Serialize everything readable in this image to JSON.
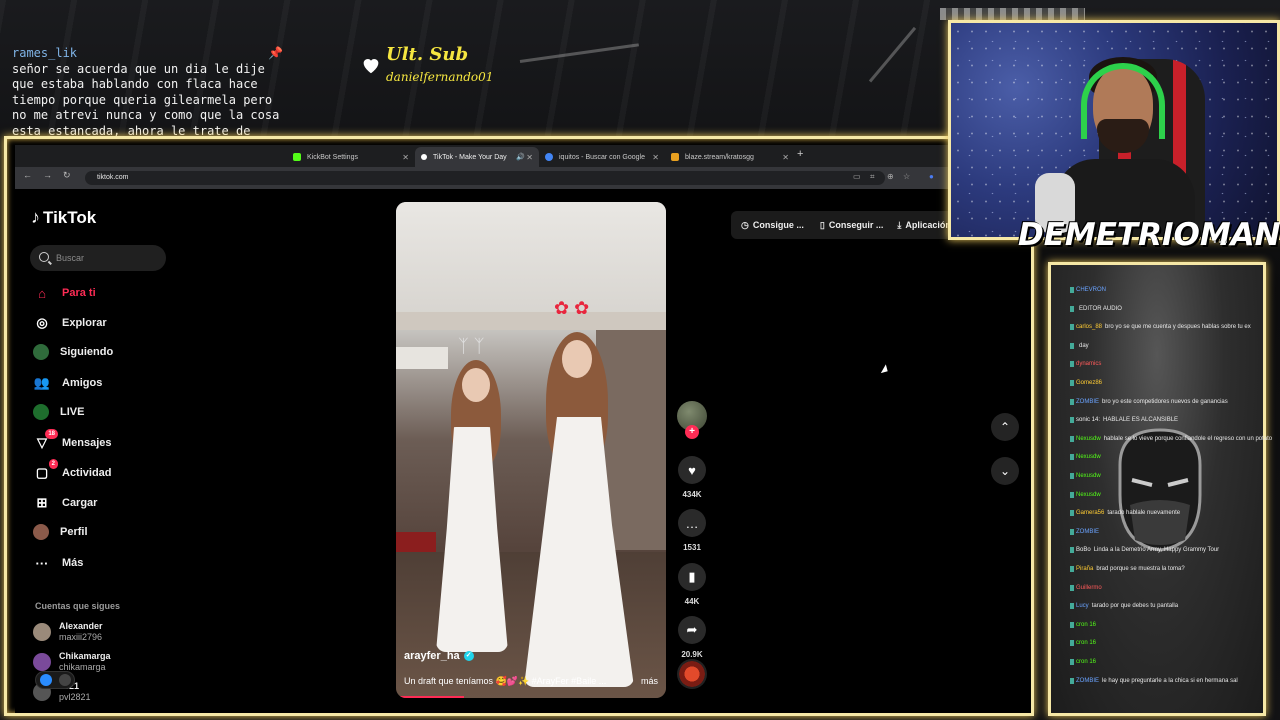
{
  "stream": {
    "pinned_user": "rames_lik",
    "pinned_message": "señor se acuerda que un dia le dije que estaba hablando con flaca hace tiempo porque queria gilearmela pero no me atrevi nunca y como que la cosa esta estancada, ahora le trate de hablar con mas intencion pero aun no",
    "last_sub_title": "Ult. Sub",
    "last_sub_user": "danielfernando01",
    "streamer_name": "DEMETRIOMAN",
    "streamer_dots": "...",
    "accent_color": "#f6e8a6"
  },
  "browser": {
    "tabs": [
      {
        "label": "KickBot Settings",
        "fav_color": "#53fc18"
      },
      {
        "label": "TikTok - Make Your Day",
        "fav_color": "#ffffff",
        "active": true
      },
      {
        "label": "iquitos - Buscar con Google",
        "fav_color": "#4285f4"
      },
      {
        "label": "blaze.stream/kratosgg",
        "fav_color": "#e8a020"
      }
    ],
    "new_tab": "+",
    "url": "tiktok.com"
  },
  "tiktok": {
    "brand": "TikTok",
    "search_placeholder": "Buscar",
    "menu": [
      {
        "label": "Para ti",
        "icon": "home-icon"
      },
      {
        "label": "Explorar",
        "icon": "compass-icon"
      },
      {
        "label": "Siguiendo",
        "icon": "following-icon"
      },
      {
        "label": "Amigos",
        "icon": "friends-icon"
      },
      {
        "label": "LIVE",
        "icon": "live-icon"
      },
      {
        "label": "Mensajes",
        "icon": "messages-icon",
        "badge": "18"
      },
      {
        "label": "Actividad",
        "icon": "activity-icon",
        "badge": "2"
      },
      {
        "label": "Cargar",
        "icon": "upload-icon"
      },
      {
        "label": "Perfil",
        "icon": "profile-icon"
      },
      {
        "label": "Más",
        "icon": "more-icon"
      }
    ],
    "following_title": "Cuentas que sigues",
    "following": [
      {
        "name": "Alexander",
        "handle": "maxiii2796"
      },
      {
        "name": "Chikamarga",
        "handle": "chikamarga"
      },
      {
        "name": "2821",
        "handle": "pvl2821"
      }
    ],
    "top_buttons": [
      "Consigue ...",
      "Conseguir ...",
      "Aplicación"
    ],
    "video": {
      "username": "arayfer_ha",
      "description": "Un draft que teníamos 🥰💕✨ #ArayFer #Baile ...",
      "more": "más",
      "progress": 0.25
    },
    "actions": {
      "likes": "434K",
      "comments": "1531",
      "saves": "44K",
      "shares": "20.9K"
    }
  },
  "chat": {
    "lines": [
      {
        "user": "CHEVRON",
        "text": "",
        "color": "#6aa3ff"
      },
      {
        "user": "",
        "text": "EDITOR AUDIO",
        "color": "#ff5a5a"
      },
      {
        "user": "carlos_88",
        "text": "bro yo se que me cuenta y despues hablas sobre tu ex",
        "color": "#ffcc33"
      },
      {
        "user": "",
        "text": "day",
        "color": "#eee"
      },
      {
        "user": "dynamics",
        "text": "",
        "color": "#ff5a5a"
      },
      {
        "user": "Gomez86",
        "text": "",
        "color": "#ffcc33"
      },
      {
        "user": "ZOMBIE",
        "text": "bro yo este competidores nuevos de ganancias",
        "color": "#6aa3ff"
      },
      {
        "user": "sonic 14:",
        "text": "HABLALE ES ALCANSIBLE",
        "color": "#eee"
      },
      {
        "user": "Nexusdw",
        "text": "hablale se lo vieve porque confiandole el regreso con un potato",
        "color": "#53fc18"
      },
      {
        "user": "Nexusdw",
        "text": "",
        "color": "#53fc18"
      },
      {
        "user": "Nexusdw",
        "text": "",
        "color": "#53fc18"
      },
      {
        "user": "Nexusdw",
        "text": "",
        "color": "#53fc18"
      },
      {
        "user": "Gamera56",
        "text": "tarado hablale nuevamente",
        "color": "#ffcc33"
      },
      {
        "user": "ZOMBIE",
        "text": "",
        "color": "#6aa3ff"
      },
      {
        "user": "BoBo",
        "text": "Linda a la Demetrio Army, Happy Grammy Tour",
        "color": "#eee"
      },
      {
        "user": "Piraña",
        "text": "brad porque se muestra la toma?",
        "color": "#ffcc33"
      },
      {
        "user": "Guillermo",
        "text": "",
        "color": "#ff5a5a"
      },
      {
        "user": "Lucy",
        "text": "tarado por que debes tu pantalla",
        "color": "#6aa3ff"
      },
      {
        "user": "cron 16",
        "text": "",
        "color": "#53fc18"
      },
      {
        "user": "cron 16",
        "text": "",
        "color": "#53fc18"
      },
      {
        "user": "cron 16",
        "text": "",
        "color": "#53fc18"
      },
      {
        "user": "ZOMBIE",
        "text": "le hay que preguntarle a la chica si en hermana sal",
        "color": "#6aa3ff"
      }
    ]
  }
}
